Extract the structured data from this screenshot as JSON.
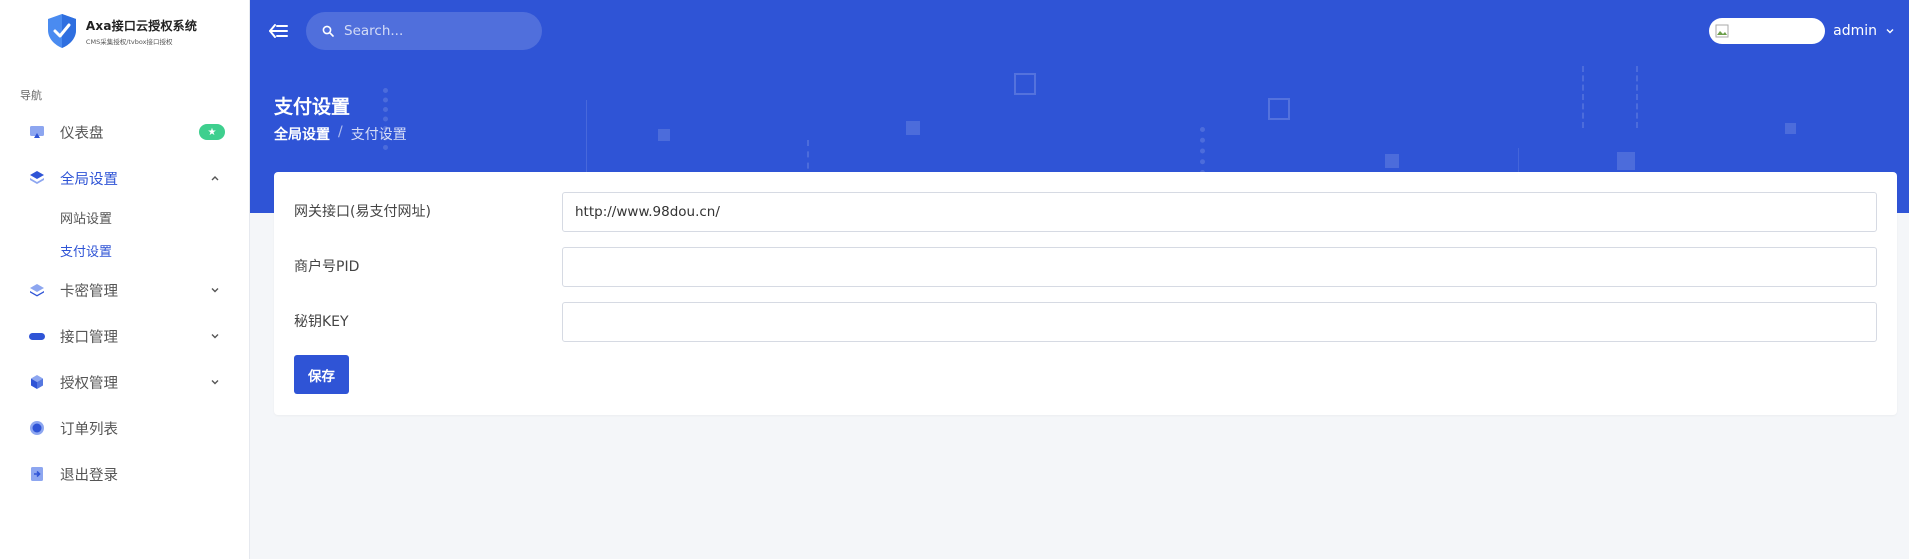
{
  "brand": {
    "title": "Axa接口云授权系统",
    "subtitle": "CMS采集授权/tvbox接口授权"
  },
  "sidebar": {
    "heading": "导航",
    "items": [
      {
        "label": "仪表盘",
        "icon": "dashboard-icon",
        "badge": "★"
      },
      {
        "label": "全局设置",
        "icon": "layers-icon",
        "expanded": true,
        "active": true,
        "children": [
          {
            "label": "网站设置"
          },
          {
            "label": "支付设置",
            "active": true
          }
        ]
      },
      {
        "label": "卡密管理",
        "icon": "stack-icon"
      },
      {
        "label": "接口管理",
        "icon": "pill-icon"
      },
      {
        "label": "授权管理",
        "icon": "cube-icon"
      },
      {
        "label": "订单列表",
        "icon": "circle-icon"
      },
      {
        "label": "退出登录",
        "icon": "logout-icon"
      }
    ]
  },
  "topbar": {
    "search_placeholder": "Search...",
    "user_name": "admin"
  },
  "page": {
    "title": "支付设置",
    "breadcrumb": [
      "全局设置",
      "支付设置"
    ]
  },
  "form": {
    "fields": [
      {
        "label": "网关接口(易支付网址)",
        "value": "http://www.98dou.cn/"
      },
      {
        "label": "商户号PID",
        "value": ""
      },
      {
        "label": "秘钥KEY",
        "value": ""
      }
    ],
    "save_label": "保存"
  },
  "colors": {
    "primary": "#2f54d6",
    "badge": "#3ecf8e"
  }
}
